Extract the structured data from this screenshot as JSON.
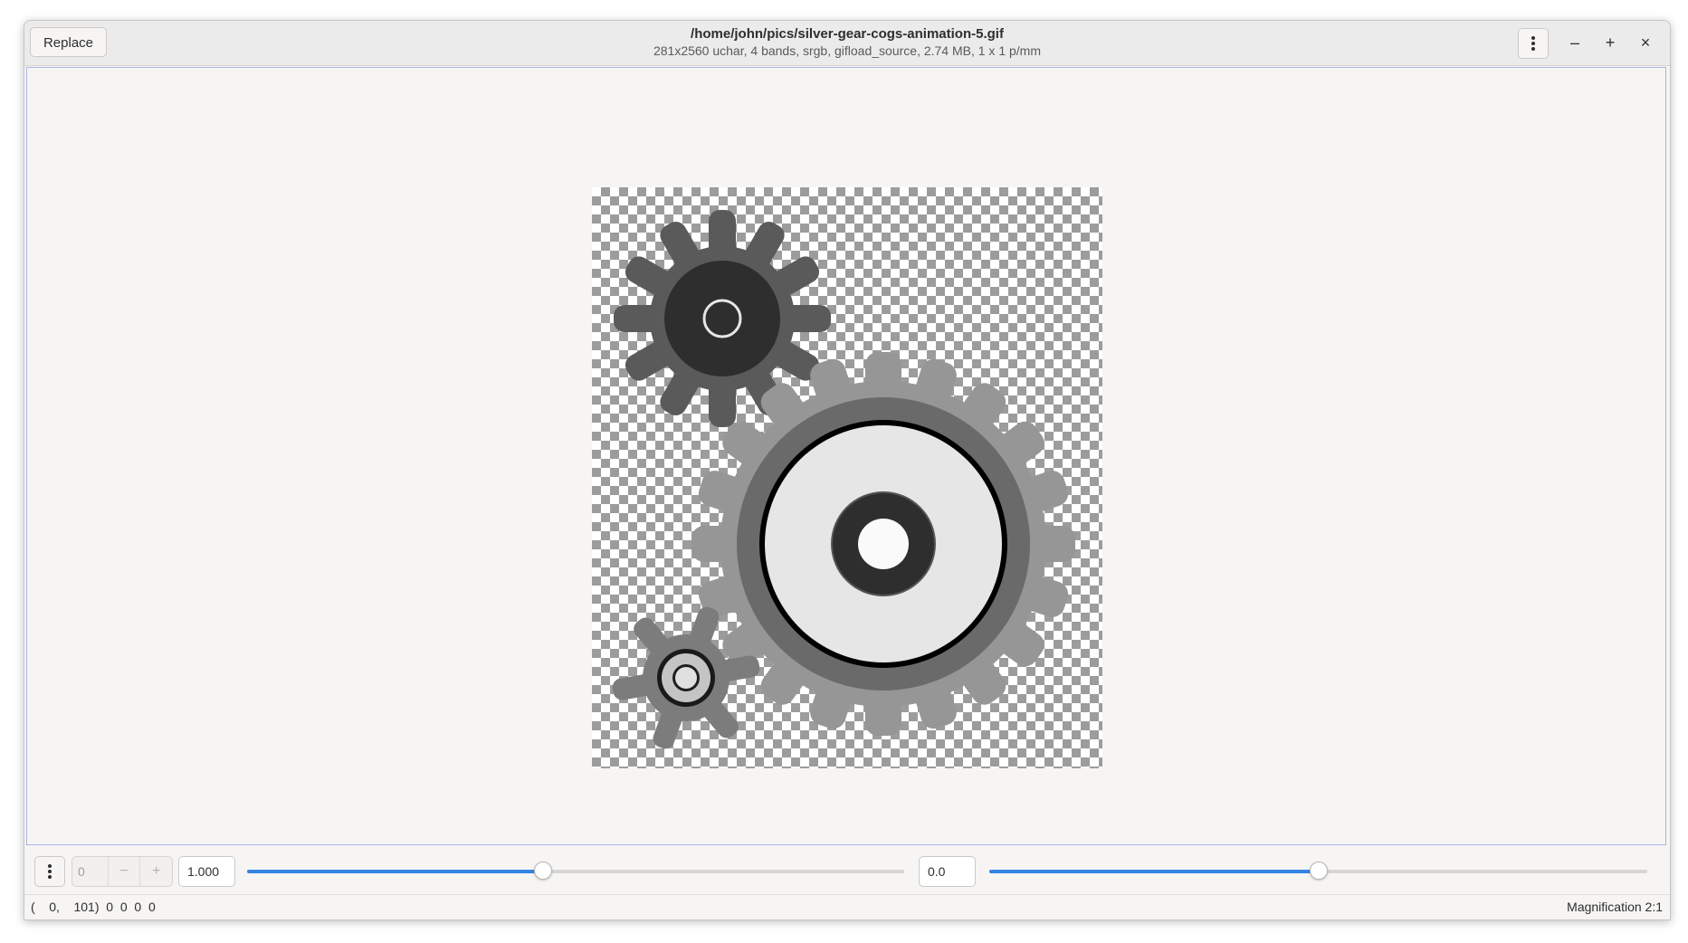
{
  "window": {
    "title": "/home/john/pics/silver-gear-cogs-animation-5.gif",
    "subtitle": "281x2560 uchar, 4 bands, srgb, gifload_source, 2.74 MB, 1 x 1 p/mm"
  },
  "titlebar": {
    "replace_label": "Replace",
    "menu_icon": "vertical-dots-icon",
    "minimize_label": "–",
    "maximize_label": "+",
    "close_label": "×"
  },
  "controls": {
    "menu_icon": "vertical-dots-icon",
    "page_value": "0",
    "page_minus": "−",
    "page_plus": "+",
    "scale_value": "1.000",
    "scale_slider_fraction": 0.45,
    "offset_value": "0.0",
    "offset_slider_fraction": 0.5,
    "accent_color": "#3584e4"
  },
  "status": {
    "pixel_readout": "(    0,    101)  0  0  0  0",
    "magnification": "Magnification 2:1"
  },
  "image": {
    "description_icon": "gear-cogs-image",
    "background": "transparency-checkerboard"
  }
}
